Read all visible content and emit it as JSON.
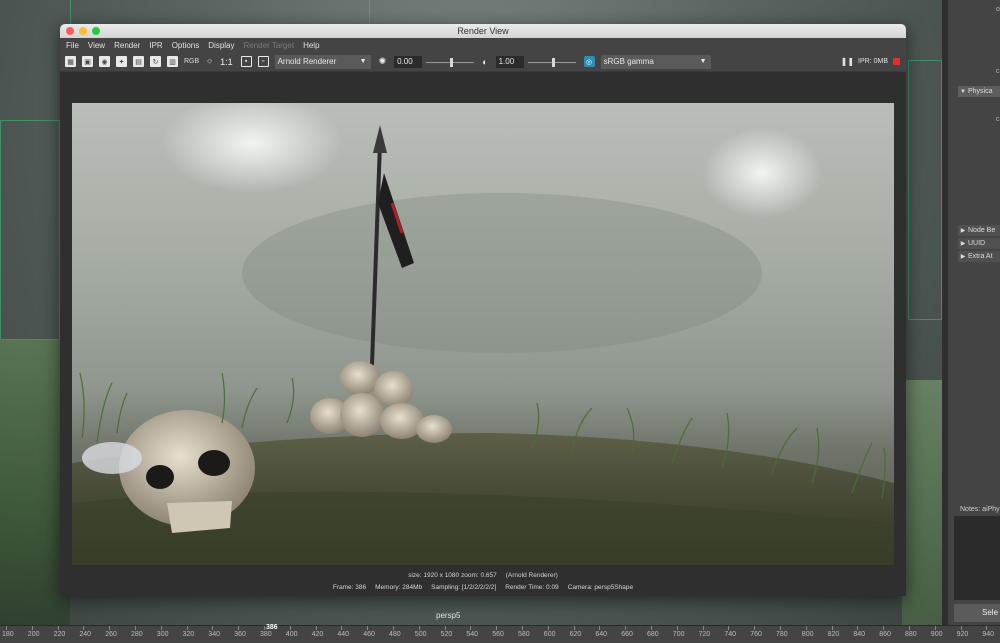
{
  "window": {
    "title": "Render View"
  },
  "menu": [
    "File",
    "View",
    "Render",
    "IPR",
    "Options",
    "Display",
    "Render Target",
    "Help"
  ],
  "menu_disabled_index": 6,
  "toolbar": {
    "rgb_label": "RGB",
    "ratio_label": "1:1",
    "renderer": "Arnold Renderer",
    "exposure_value": "0.00",
    "gamma_value": "1.00",
    "color_space": "sRGB gamma",
    "ipr_status": "IPR: 0MB"
  },
  "render_info": {
    "size_line": "size: 1920 x 1080 zoom: 0.657     (Arnold Renderer)",
    "stats_line": "Frame: 386     Memory: 284Mb     Sampling: [1/2/2/2/2/2]     Render Time: 0:09     Camera: persp5Shape"
  },
  "viewport": {
    "camera_label": "persp5"
  },
  "attribute_editor": {
    "sections": [
      {
        "label": "Physica",
        "expanded": true
      },
      {
        "label": "Node Be",
        "expanded": false
      },
      {
        "label": "UUID",
        "expanded": false
      },
      {
        "label": "Extra At",
        "expanded": false
      }
    ],
    "notes_label": "Notes:  aiPhy",
    "select_button": "Sele"
  },
  "timeline": {
    "ticks": [
      "180",
      "200",
      "220",
      "240",
      "260",
      "280",
      "300",
      "320",
      "340",
      "360",
      "380",
      "400",
      "420",
      "440",
      "460",
      "480",
      "500",
      "520",
      "540",
      "560",
      "580",
      "600",
      "620",
      "640",
      "660",
      "680",
      "700",
      "720",
      "740",
      "760",
      "780",
      "800",
      "820",
      "840",
      "860",
      "880",
      "900",
      "920",
      "940"
    ],
    "current_frame": "386"
  },
  "colors": {
    "accent_ipr_stop": "#e03030",
    "wireframe": "#3dbf7a"
  }
}
